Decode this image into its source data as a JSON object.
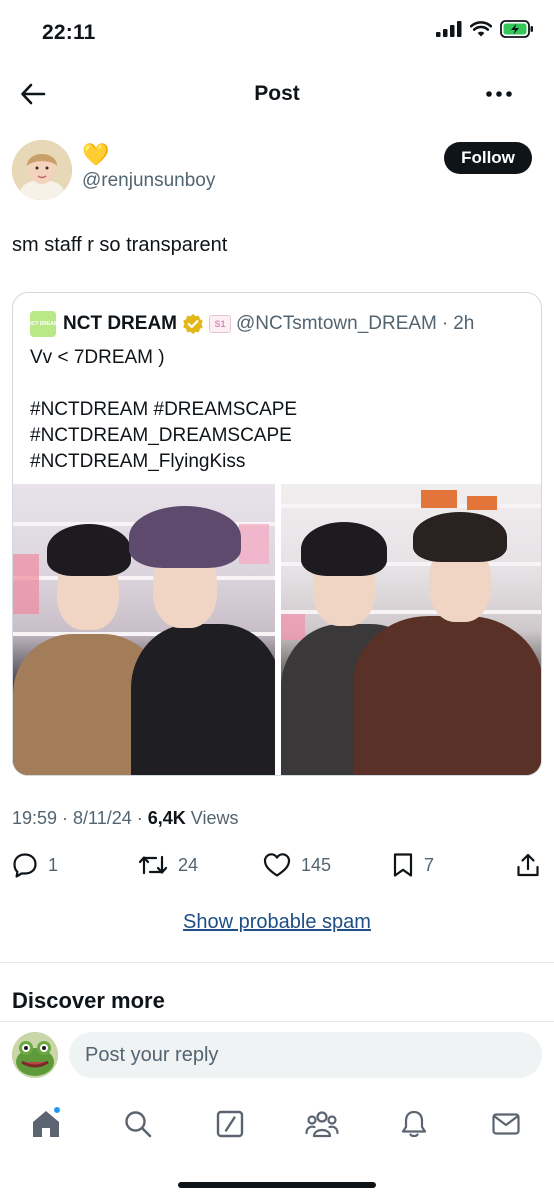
{
  "status_bar": {
    "time": "22:11"
  },
  "header": {
    "title": "Post"
  },
  "post": {
    "author_name": "💛",
    "author_handle": "@renjunsunboy",
    "follow_label": "Follow",
    "text": "sm staff r so transparent",
    "timestamp": "19:59 · 8/11/24 · ",
    "views_count": "6,4K",
    "views_label": " Views"
  },
  "quote": {
    "avatar_text": "NCT DREAM",
    "name": "NCT DREAM",
    "affiliate_badge": "S1",
    "handle": "@NCTsmtown_DREAM",
    "separator": "·",
    "time": "2h",
    "lines": [
      "Vv < 7DREAM )",
      "",
      "#NCTDREAM #DREAMSCAPE",
      "#NCTDREAM_DREAMSCAPE",
      "#NCTDREAM_FlyingKiss"
    ]
  },
  "actions": {
    "replies": "1",
    "reposts": "24",
    "likes": "145",
    "bookmarks": "7"
  },
  "spam_link": "Show probable spam",
  "discover_title": "Discover more",
  "reply": {
    "placeholder": "Post your reply"
  },
  "colors": {
    "text": "#0f1419",
    "secondary": "#536471",
    "link": "#1d4f86",
    "accent": "#1d9bf0",
    "verified_gold": "#e2b719",
    "battery_green": "#34c759"
  },
  "icons": {
    "tabs": [
      "home-icon",
      "search-icon",
      "grok-icon",
      "communities-icon",
      "notifications-icon",
      "messages-icon"
    ]
  }
}
